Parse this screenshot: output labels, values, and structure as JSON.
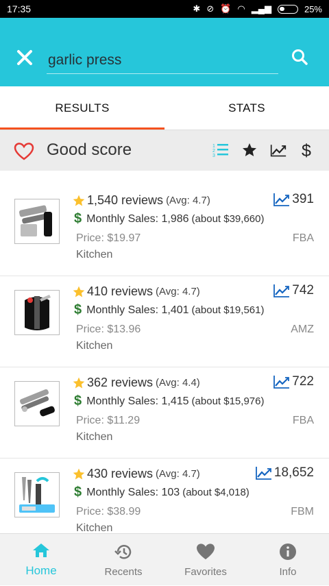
{
  "status_bar": {
    "time": "17:35",
    "battery": "25%"
  },
  "search": {
    "query": "garlic press"
  },
  "tabs": [
    {
      "label": "RESULTS",
      "active": true
    },
    {
      "label": "STATS",
      "active": false
    }
  ],
  "filter": {
    "label": "Good score"
  },
  "products": [
    {
      "reviews": "1,540 reviews",
      "avg": "(Avg: 4.7)",
      "sales": "Monthly Sales: 1,986",
      "about": "(about $39,660)",
      "price": "Price: $19.97",
      "category": "Kitchen",
      "rank": "391",
      "seller": "FBA"
    },
    {
      "reviews": "410 reviews",
      "avg": "(Avg: 4.7)",
      "sales": "Monthly Sales: 1,401",
      "about": "(about $19,561)",
      "price": "Price: $13.96",
      "category": "Kitchen",
      "rank": "742",
      "seller": "AMZ"
    },
    {
      "reviews": "362 reviews",
      "avg": "(Avg: 4.4)",
      "sales": "Monthly Sales: 1,415",
      "about": "(about $15,976)",
      "price": "Price: $11.29",
      "category": "Kitchen",
      "rank": "722",
      "seller": "FBA"
    },
    {
      "reviews": "430 reviews",
      "avg": "(Avg: 4.7)",
      "sales": "Monthly Sales: 103",
      "about": "(about $4,018)",
      "price": "Price: $38.99",
      "category": "Kitchen",
      "rank": "18,652",
      "seller": "FBM"
    }
  ],
  "nav": [
    {
      "label": "Home",
      "icon": "home-icon",
      "active": true
    },
    {
      "label": "Recents",
      "icon": "history-icon",
      "active": false
    },
    {
      "label": "Favorites",
      "icon": "heart-icon",
      "active": false
    },
    {
      "label": "Info",
      "icon": "info-icon",
      "active": false
    }
  ],
  "colors": {
    "accent": "#26c6da",
    "tab_indicator": "#f4511e",
    "star": "#fbc02d",
    "money": "#2e7d32",
    "trend": "#1565c0",
    "heart": "#e53935"
  }
}
